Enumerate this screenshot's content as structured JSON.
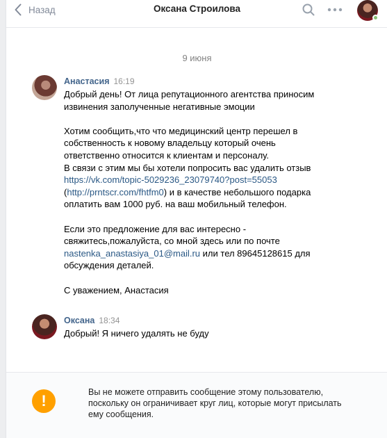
{
  "header": {
    "back_label": "Назад",
    "title": "Оксана Строилова",
    "icons": {
      "back": "chevron-left-icon",
      "search": "search-icon",
      "more": "more-icon"
    },
    "avatar": "contact-avatar"
  },
  "date_separator": "9 июня",
  "messages": [
    {
      "author": "Анастасия",
      "time": "16:19",
      "lines": [
        "Добрый день! От лица репутационного агентства приносим",
        "извинения заполученные негативные эмоции",
        "",
        "Хотим сообщить,что что медицинский центр перешел в",
        "собственность к новому владельцу который очень",
        "ответственно относится к клиентам и персоналу.",
        "В связи с этим мы бы хотели попросить вас удалить отзыв"
      ],
      "link1": "https://vk.com/topic-5029236_23079740?post=55053",
      "link2_open": "(",
      "link2": "http://prntscr.com/fhtfm0",
      "link2_after": ") и в качестве небольшого подарка",
      "lines2": [
        "оплатить вам 1000 руб. на ваш мобильный телефон.",
        "",
        "Если это предложение для вас интересно -",
        "свяжитесь,пожалуйста, со мной здесь или по почте"
      ],
      "email": "nastenka_anastasiya_01@mail.ru",
      "email_after": " или тел 89645128615 для",
      "lines3": [
        "обсуждения деталей.",
        "",
        "С уважением, Анастасия"
      ]
    },
    {
      "author": "Оксана",
      "time": "18:34",
      "text": "Добрый! Я ничего удалять не буду"
    }
  ],
  "footer": {
    "icon": "!",
    "lines": [
      "Вы не можете отправить сообщение этому пользователю,",
      "поскольку он ограничивает круг лиц, которые могут присылать",
      "ему сообщения."
    ]
  },
  "colors": {
    "link": "#2a5885",
    "author": "#42648b",
    "warning": "#ffa000",
    "online": "#8ac176"
  }
}
